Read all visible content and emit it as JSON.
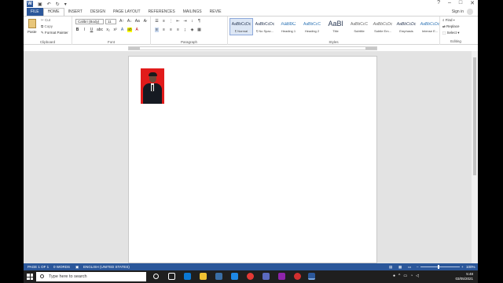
{
  "titlebar": {
    "win_buttons": [
      "?",
      "–",
      "□",
      "✕"
    ]
  },
  "tabs": [
    {
      "label": "FILE"
    },
    {
      "label": "HOME"
    },
    {
      "label": "INSERT"
    },
    {
      "label": "DESIGN"
    },
    {
      "label": "PAGE LAYOUT"
    },
    {
      "label": "REFERENCES"
    },
    {
      "label": "MAILINGS"
    },
    {
      "label": "REVIE"
    }
  ],
  "signin": "Sign in",
  "ribbon": {
    "clipboard": {
      "paste": "Paste",
      "cut": "Cut",
      "copy": "Copy",
      "format_painter": "Format Painter",
      "label": "Clipboard"
    },
    "font": {
      "name": "Calibri (Body)",
      "size": "11",
      "label": "Font"
    },
    "paragraph": {
      "label": "Paragraph"
    },
    "styles": {
      "label": "Styles",
      "items": [
        {
          "preview": "AaBbCcDc",
          "name": "¶ Normal"
        },
        {
          "preview": "AaBbCcDc",
          "name": "¶ No Spac..."
        },
        {
          "preview": "AaBbC",
          "name": "Heading 1"
        },
        {
          "preview": "AaBbCcC",
          "name": "Heading 2"
        },
        {
          "preview": "AaBl",
          "name": "Title"
        },
        {
          "preview": "AaBbCcC",
          "name": "Subtitle"
        },
        {
          "preview": "AaBbCcDc",
          "name": "Subtle Em..."
        },
        {
          "preview": "AaBbCcDc",
          "name": "Emphasis"
        },
        {
          "preview": "AaBbCcDc",
          "name": "Intense E..."
        }
      ]
    },
    "editing": {
      "find": "Find",
      "replace": "Replace",
      "select": "Select",
      "label": "Editing"
    }
  },
  "statusbar": {
    "page": "PAGE 1 OF 1",
    "words": "0 WORDS",
    "language": "ENGLISH (UNITED STATES)",
    "zoom": "100%"
  },
  "taskbar": {
    "search_placeholder": "Type here to search",
    "time": "5:48",
    "date": "03/05/2021"
  },
  "colors": {
    "word_blue": "#2b579a",
    "photo_bg": "#e11b1b"
  }
}
